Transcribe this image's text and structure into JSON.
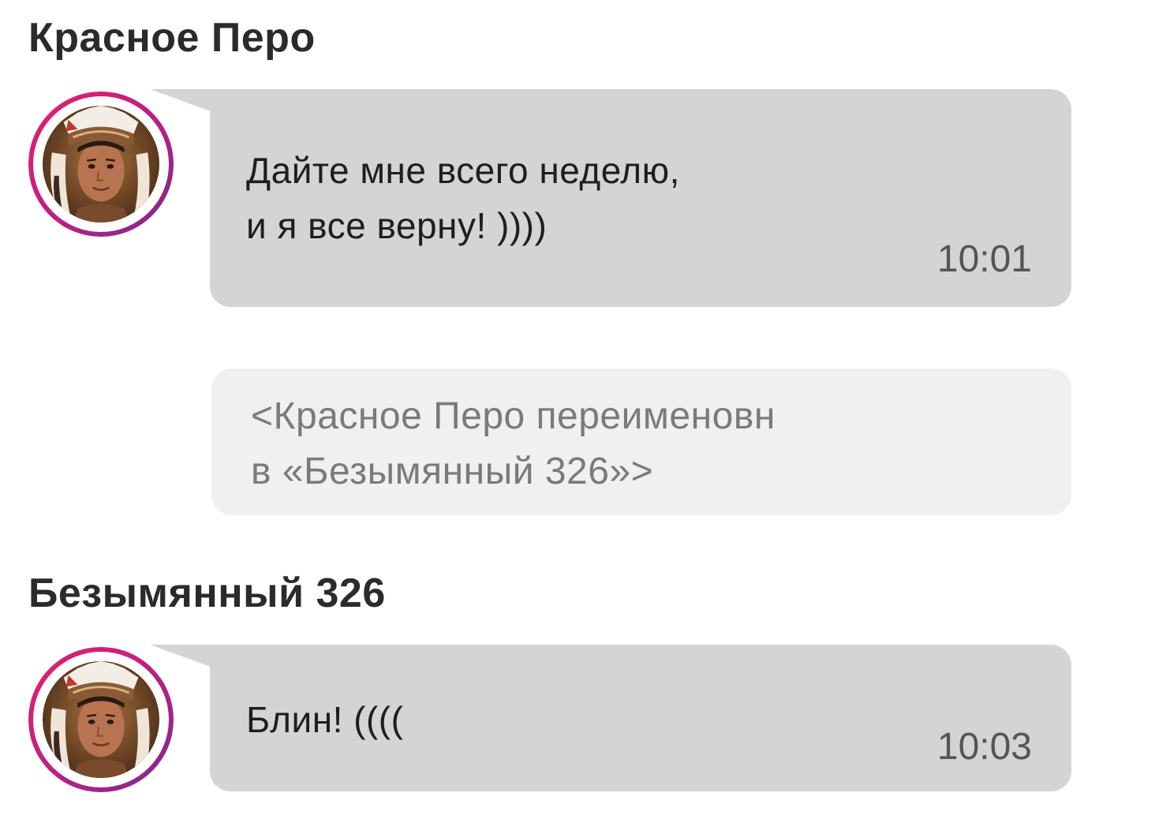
{
  "messages": [
    {
      "sender": "Красное Перо",
      "avatar_icon": "chief-headdress-avatar-icon",
      "text": "Дайте мне всего неделю,\nи я все верну! ))))",
      "time": "10:01"
    },
    {
      "sender": "Безымянный 326",
      "avatar_icon": "chief-headdress-avatar-icon",
      "text": "Блин! ((((",
      "time": "10:03"
    }
  ],
  "system_notice": {
    "text": "<Красное Перо переименовн\nв «Безымянный 326»>"
  },
  "colors": {
    "incoming_bubble": "#d4d4d4",
    "system_bubble": "#f0f0f0",
    "avatar_ring_start": "#e2226b",
    "avatar_ring_end": "#7b2a8e"
  }
}
